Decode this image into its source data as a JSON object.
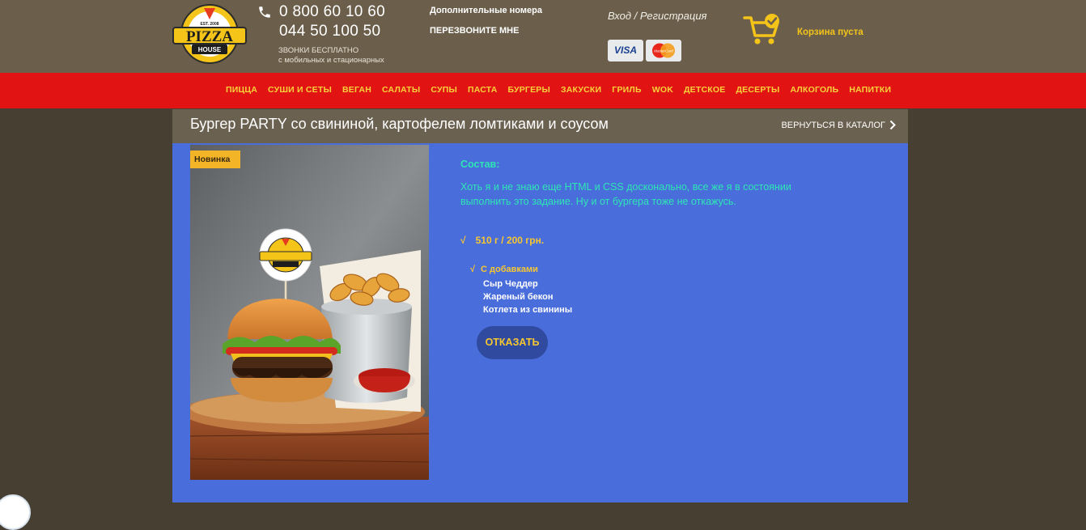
{
  "header": {
    "logo": {
      "line1": "EST. 2008",
      "line2": "PIZZA",
      "line3": "HOUSE"
    },
    "phone_primary": "0 800 60 10 60",
    "phone_secondary": "044 50 100 50",
    "free_note_1": "ЗВОНКИ БЕСПЛАТНО",
    "free_note_2": "с мобильных и стационарных",
    "extra_numbers": "Дополнительные номера",
    "callback": "ПЕРЕЗВОНИТЕ МНЕ",
    "login": "Вход / Регистрация",
    "payment_visa": "VISA",
    "payment_mastercard": "MasterCard",
    "cart_label": "Корзина пуста",
    "icons": {
      "phone": "phone-icon",
      "cart": "cart-icon"
    }
  },
  "nav": {
    "items": [
      "ПИЦЦА",
      "СУШИ И СЕТЫ",
      "ВЕГАН",
      "САЛАТЫ",
      "СУПЫ",
      "ПАСТА",
      "БУРГЕРЫ",
      "ЗАКУСКИ",
      "ГРИЛЬ",
      "WOK",
      "ДЕТСКОЕ",
      "ДЕСЕРТЫ",
      "АЛКОГОЛЬ",
      "НАПИТКИ"
    ]
  },
  "product": {
    "title": "Бургер PARTY со свининой, картофелем ломтиками и соусом",
    "back_link": "ВЕРНУТЬСЯ В КАТАЛОГ",
    "badge": "Новинка",
    "composition_title": "Состав:",
    "description": "Хоть я и не знаю еще HTML и CSS досконально, все же я в состоянии выполнить это задание. Ну и от бургера тоже не откажусь.",
    "price_check": "√",
    "price": "510 г / 200 грн.",
    "addons_check": "√",
    "addons_heading": "С добавками",
    "addons": [
      "Сыр Чеддер",
      "Жареный бекон",
      "Котлета из свинины"
    ],
    "refuse_button": "ОТКАЗАТЬ"
  },
  "colors": {
    "header_bg": "#6b5f4b",
    "nav_bg": "#e11313",
    "nav_text": "#f7d23a",
    "content_bg": "#496ddb",
    "accent_teal": "#2ee6b5",
    "accent_yellow": "#f7c730",
    "button_bg": "#2f4a9e"
  }
}
